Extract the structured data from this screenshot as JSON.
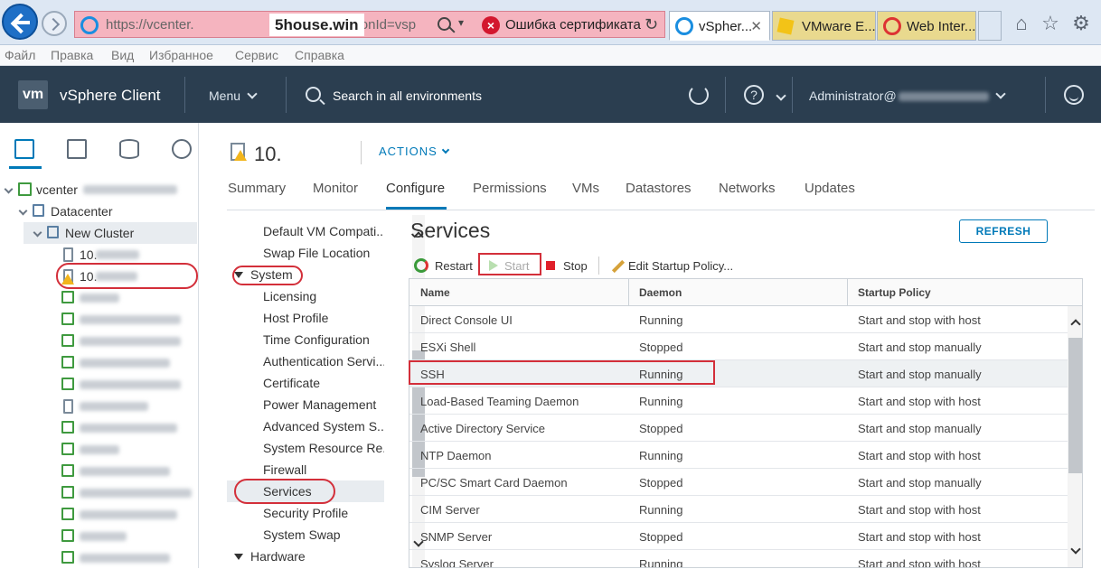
{
  "browser": {
    "url_prefix": "https://vcenter.",
    "url_suffix": "/ui/#?extensionId=vsp",
    "watermark": "5house.win",
    "cert_error": "Ошибка сертификата",
    "tabs": [
      {
        "label": "vSpher...",
        "active": true
      },
      {
        "label": "VMware E...",
        "active": false
      },
      {
        "label": "Web Inter...",
        "active": false
      }
    ],
    "menu": [
      "Файл",
      "Правка",
      "Вид",
      "Избранное",
      "Сервис",
      "Справка"
    ]
  },
  "header": {
    "logo": "vm",
    "title": "vSphere Client",
    "menu_label": "Menu",
    "search_label": "Search in all environments",
    "user": "Administrator@",
    "help": "?"
  },
  "tree": {
    "vcenter": "vcenter",
    "datacenter": "Datacenter",
    "cluster": "New Cluster",
    "host1": "10.",
    "host2": "10."
  },
  "object": {
    "title": "10.",
    "actions": "ACTIONS"
  },
  "tabs": [
    "Summary",
    "Monitor",
    "Configure",
    "Permissions",
    "VMs",
    "Datastores",
    "Networks",
    "Updates"
  ],
  "settings": {
    "items_top": [
      "Default VM Compati...",
      "Swap File Location"
    ],
    "group_system": "System",
    "system_items": [
      "Licensing",
      "Host Profile",
      "Time Configuration",
      "Authentication Servi...",
      "Certificate",
      "Power Management",
      "Advanced System S...",
      "System Resource Re...",
      "Firewall",
      "Services",
      "Security Profile",
      "System Swap"
    ],
    "group_hardware": "Hardware"
  },
  "services": {
    "title": "Services",
    "refresh": "REFRESH",
    "toolbar": {
      "restart": "Restart",
      "start": "Start",
      "stop": "Stop",
      "edit": "Edit Startup Policy..."
    },
    "columns": [
      "Name",
      "Daemon",
      "Startup Policy"
    ],
    "rows": [
      {
        "name": "Direct Console UI",
        "daemon": "Running",
        "policy": "Start and stop with host"
      },
      {
        "name": "ESXi Shell",
        "daemon": "Stopped",
        "policy": "Start and stop manually"
      },
      {
        "name": "SSH",
        "daemon": "Running",
        "policy": "Start and stop manually"
      },
      {
        "name": "Load-Based Teaming Daemon",
        "daemon": "Running",
        "policy": "Start and stop with host"
      },
      {
        "name": "Active Directory Service",
        "daemon": "Stopped",
        "policy": "Start and stop manually"
      },
      {
        "name": "NTP Daemon",
        "daemon": "Running",
        "policy": "Start and stop with host"
      },
      {
        "name": "PC/SC Smart Card Daemon",
        "daemon": "Stopped",
        "policy": "Start and stop manually"
      },
      {
        "name": "CIM Server",
        "daemon": "Running",
        "policy": "Start and stop with host"
      },
      {
        "name": "SNMP Server",
        "daemon": "Stopped",
        "policy": "Start and stop with host"
      },
      {
        "name": "Syslog Server",
        "daemon": "Running",
        "policy": "Start and stop with host"
      }
    ]
  },
  "colors": {
    "header_bg": "#2b3e50",
    "accent": "#0079b8",
    "annotation": "#d32f3a"
  }
}
